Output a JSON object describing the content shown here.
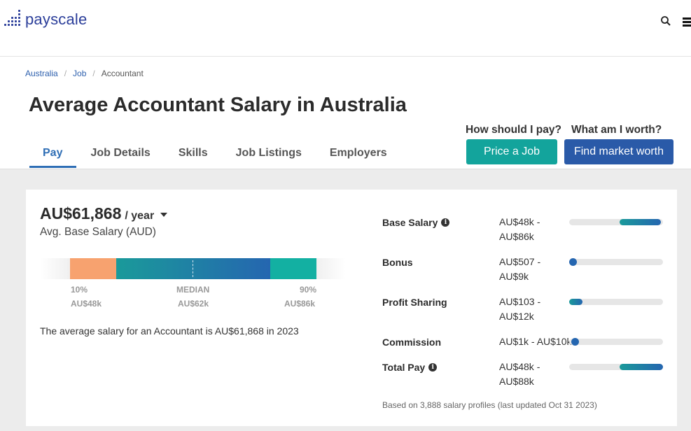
{
  "header": {
    "logo_text": "payscale",
    "search_icon": "search-icon",
    "menu_icon": "hamburger-menu-icon"
  },
  "breadcrumb": {
    "items": [
      "Australia",
      "Job",
      "Accountant"
    ],
    "separator": "/"
  },
  "page_title": "Average Accountant Salary in Australia",
  "tabs": [
    {
      "label": "Pay",
      "active": true
    },
    {
      "label": "Job Details",
      "active": false
    },
    {
      "label": "Skills",
      "active": false
    },
    {
      "label": "Job Listings",
      "active": false
    },
    {
      "label": "Employers",
      "active": false
    }
  ],
  "cta": {
    "question_pay": "How should I pay?",
    "question_worth": "What am I worth?",
    "price_button": "Price a Job",
    "find_button": "Find market worth"
  },
  "salary": {
    "amount": "AU$61,868",
    "unit": "/ year",
    "subtitle": "Avg. Base Salary (AUD)",
    "range": {
      "p10_label": "10%",
      "p10_value": "AU$48k",
      "median_label": "MEDIAN",
      "median_value": "AU$62k",
      "p90_label": "90%",
      "p90_value": "AU$86k"
    },
    "summary": "The average salary for an Accountant is AU$61,868 in 2023"
  },
  "comp_rows": [
    {
      "label": "Base Salary",
      "has_info": true,
      "range": "AU$48k - AU$86k",
      "fill_start": 0.54,
      "fill_end": 0.98
    },
    {
      "label": "Bonus",
      "has_info": false,
      "range": "AU$507 - AU$9k",
      "fill_start": 0.0,
      "fill_end": 0.08
    },
    {
      "label": "Profit Sharing",
      "has_info": false,
      "range": "AU$103 - AU$12k",
      "fill_start": 0.0,
      "fill_end": 0.14
    },
    {
      "label": "Commission",
      "has_info": false,
      "range": "AU$1k - AU$10k",
      "fill_start": 0.0,
      "fill_end": 0.08
    },
    {
      "label": "Total Pay",
      "has_info": true,
      "range": "AU$48k - AU$88k",
      "fill_start": 0.54,
      "fill_end": 1.0
    }
  ],
  "footnote": "Based on 3,888 salary profiles (last updated Oct 31 2023)",
  "colors": {
    "brand_blue": "#2b3e9a",
    "teal": "#13a49c",
    "blue_button": "#2a5aa8",
    "orange_segment": "#f7a26f",
    "active_tab": "#2e6eb5"
  }
}
